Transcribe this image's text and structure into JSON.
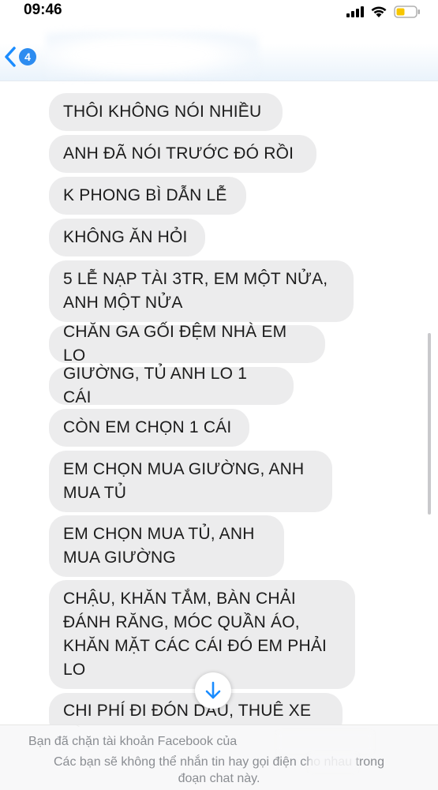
{
  "status_bar": {
    "time": "09:46"
  },
  "nav": {
    "back_badge": "4"
  },
  "messages": [
    "THÔI KHÔNG NÓI NHIỀU",
    "ANH ĐÃ NÓI TRƯỚC ĐÓ RỒI",
    "K PHONG BÌ DẪN LỄ",
    "KHÔNG ĂN HỎI",
    "5 LỄ NẠP TÀI 3TR, EM MỘT NỬA,\nANH MỘT NỬA",
    "CHĂN GA GỐI ĐỆM NHÀ EM LO",
    "GIƯỜNG, TỦ ANH LO 1 CÁI",
    "CÒN EM CHỌN 1 CÁI",
    "EM CHỌN MUA GIƯỜNG, ANH\nMUA TỦ",
    "EM CHỌN MUA TỦ, ANH\nMUA GIƯỜNG",
    "CHẬU, KHĂN TẮM, BÀN CHẢI\nĐÁNH RĂNG, MÓC QUẦN ÁO,\nKHĂN MẶT CÁC CÁI ĐÓ EM PHẢI\nLO",
    "CHI PHÍ ĐI ĐÓN DÂU, THUÊ XE LÀ"
  ],
  "blocked_notice": {
    "line1": "Bạn đã chặn tài khoản Facebook của",
    "line2": "Các bạn sẽ không thể nhắn tin hay gọi điện cho nhau trong",
    "line3": "đoạn chat này."
  }
}
